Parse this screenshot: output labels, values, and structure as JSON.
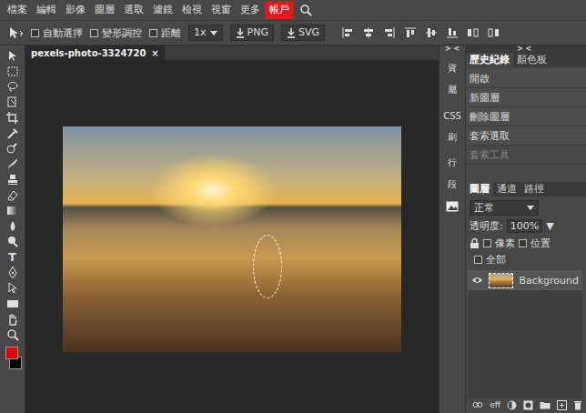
{
  "menu": [
    {
      "label": "檔案",
      "selected": false
    },
    {
      "label": "編輯",
      "selected": false
    },
    {
      "label": "影像",
      "selected": false
    },
    {
      "label": "圖層",
      "selected": false
    },
    {
      "label": "選取",
      "selected": false
    },
    {
      "label": "濾鏡",
      "selected": false
    },
    {
      "label": "檢視",
      "selected": false
    },
    {
      "label": "視窗",
      "selected": false
    },
    {
      "label": "更多",
      "selected": false
    },
    {
      "label": "帳戶",
      "selected": true
    }
  ],
  "options_bar": {
    "checkboxes": [
      {
        "label": "自動選擇",
        "checked": false
      },
      {
        "label": "變形調控",
        "checked": false
      },
      {
        "label": "距離",
        "checked": false
      }
    ],
    "zoom": "1x",
    "export_buttons": [
      "PNG",
      "SVG"
    ]
  },
  "type_tool_glyph": "T",
  "tool_colors": [
    {
      "name": "foreground",
      "color": "#e00000"
    },
    {
      "name": "background",
      "color": "#000000"
    }
  ],
  "document_tab": {
    "title": "pexels-photo-3324720",
    "close": "×"
  },
  "dock_collapse": "> <",
  "side_dock": [
    "資",
    "屬",
    "CSS",
    "刷",
    "行",
    "段"
  ],
  "history_panel": {
    "tabs": [
      {
        "label": "歷史紀錄",
        "selected": true
      },
      {
        "label": "顏色板",
        "selected": false
      }
    ],
    "items": [
      {
        "label": "開啟",
        "disabled": false
      },
      {
        "label": "新圖層",
        "disabled": false
      },
      {
        "label": "刪除圖層",
        "disabled": false
      },
      {
        "label": "套索選取",
        "disabled": false
      },
      {
        "label": "套索工具",
        "disabled": true
      }
    ]
  },
  "layers_panel": {
    "tabs": [
      {
        "label": "圖層",
        "selected": true
      },
      {
        "label": "通道",
        "selected": false
      },
      {
        "label": "路徑",
        "selected": false
      }
    ],
    "blend_mode": "正常",
    "opacity_label": "透明度:",
    "opacity": "100%",
    "opacity_arrow": "▼",
    "locks": [
      {
        "label": "像素",
        "checked": false
      },
      {
        "label": "位置",
        "checked": false
      },
      {
        "label": "全部",
        "checked": false
      }
    ],
    "layers": [
      {
        "name": "Background",
        "visible": true,
        "selected": true
      }
    ],
    "footer_label": "eff"
  }
}
